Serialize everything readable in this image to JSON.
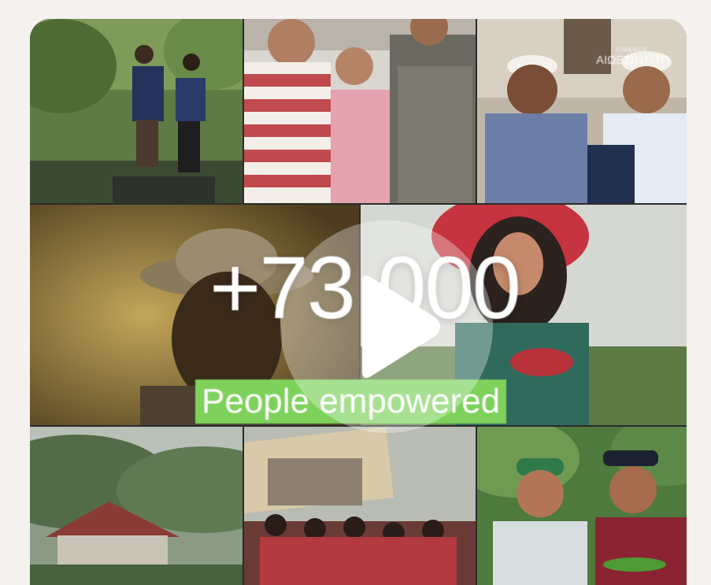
{
  "video": {
    "stat_number": "+73 000",
    "stat_caption": "People empowered",
    "watermark_small": "ORANGE",
    "watermark_text": "ΑΙΩΕΣΙΝΤΙΤΠ",
    "play_icon": "play-icon",
    "accent_color": "#7ed25c"
  }
}
